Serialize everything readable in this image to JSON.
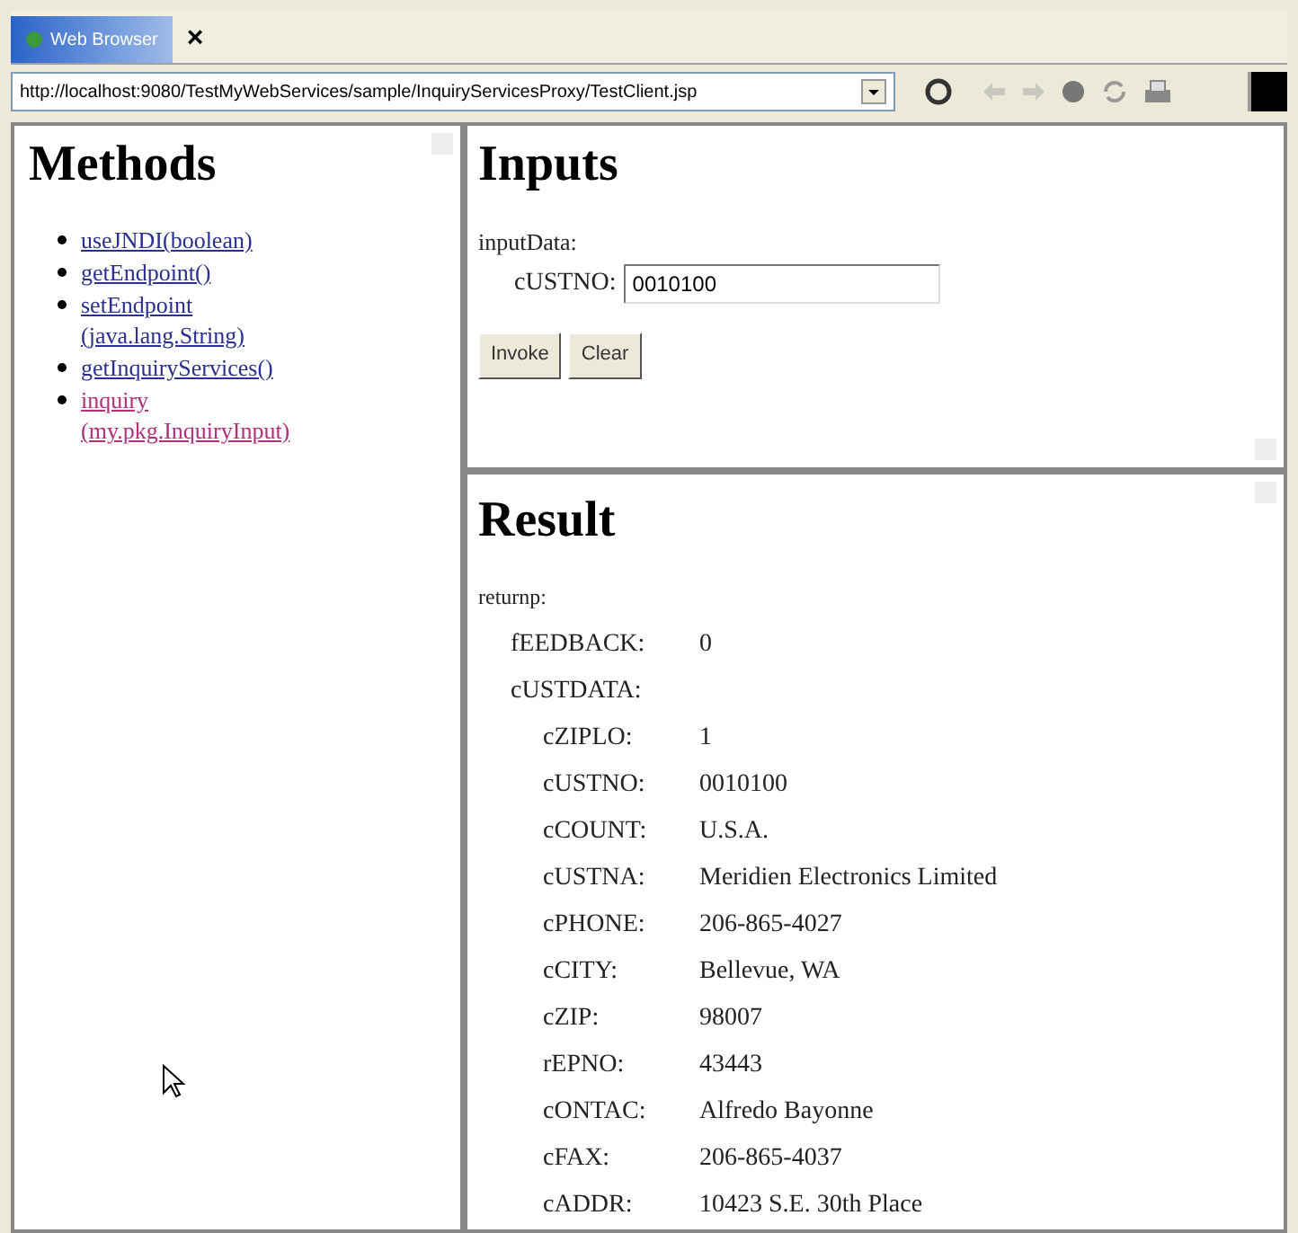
{
  "tab": {
    "title": "Web Browser",
    "close": "×"
  },
  "address_bar": {
    "url": "http://localhost:9080/TestMyWebServices/sample/InquiryServicesProxy/TestClient.jsp"
  },
  "methods": {
    "title": "Methods",
    "items": [
      {
        "name": "useJNDI(boolean)",
        "visited": false
      },
      {
        "name": "getEndpoint()",
        "visited": false
      },
      {
        "name": "setEndpoint",
        "params": "(java.lang.String)",
        "visited": false
      },
      {
        "name": "getInquiryServices()",
        "visited": false
      },
      {
        "name": "inquiry",
        "params": "(my.pkg.InquiryInput)",
        "visited": true
      }
    ]
  },
  "inputs": {
    "title": "Inputs",
    "group": "inputData:",
    "fields": [
      {
        "label": "cUSTNO:",
        "value": "0010100"
      }
    ],
    "buttons": [
      "Invoke",
      "Clear"
    ]
  },
  "result": {
    "title": "Result",
    "tree": [
      {
        "label": "returnp:",
        "children": [
          {
            "label": "fEEDBACK:",
            "value": "0"
          },
          {
            "label": "cUSTDATA:",
            "children": [
              {
                "label": "cZIPLO:",
                "value": "1"
              },
              {
                "label": "cUSTNO:",
                "value": "0010100"
              },
              {
                "label": "cCOUNT:",
                "value": "U.S.A."
              },
              {
                "label": "cUSTNA:",
                "value": "Meridien Electronics Limited"
              },
              {
                "label": "cPHONE:",
                "value": "206-865-4027"
              },
              {
                "label": "cCITY:",
                "value": "Bellevue, WA"
              },
              {
                "label": "cZIP:",
                "value": "98007"
              },
              {
                "label": "rEPNO:",
                "value": "43443"
              },
              {
                "label": "cONTAC:",
                "value": "Alfredo Bayonne"
              },
              {
                "label": "cFAX:",
                "value": "206-865-4037"
              },
              {
                "label": "cADDR:",
                "value": "10423 S.E. 30th Place"
              }
            ]
          }
        ]
      }
    ]
  }
}
